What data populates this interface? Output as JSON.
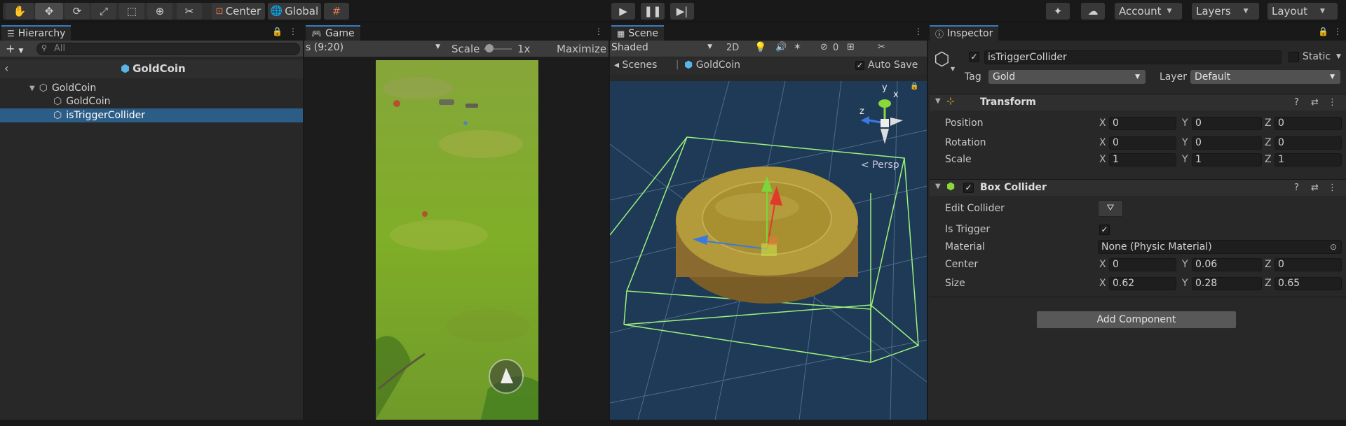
{
  "toolbar": {
    "center_label": "Center",
    "global_label": "Global",
    "account_label": "Account",
    "layers_label": "Layers",
    "layout_label": "Layout"
  },
  "hierarchy": {
    "tab_label": "Hierarchy",
    "search_placeholder": "All",
    "scene_title": "GoldCoin",
    "items": [
      {
        "label": "GoldCoin"
      },
      {
        "label": "GoldCoin"
      },
      {
        "label": "isTriggerCollider"
      }
    ]
  },
  "game": {
    "tab_label": "Game",
    "aspect_label": "s (9:20)",
    "scale_label": "Scale",
    "scale_value": "1x",
    "maximize_label": "Maximize"
  },
  "scene": {
    "tab_label": "Scene",
    "shading_label": "Shaded",
    "mode_2d": "2D",
    "hidden_count": "0",
    "scenes_label": "Scenes",
    "prefab_label": "GoldCoin",
    "autosave_label": "Auto Save",
    "persp_label": "< Persp",
    "gizmo_y": "y",
    "gizmo_x": "x",
    "gizmo_z": "z"
  },
  "inspector": {
    "tab_label": "Inspector",
    "object_name": "isTriggerCollider",
    "static_label": "Static",
    "tag_label": "Tag",
    "tag_value": "Gold",
    "layer_label": "Layer",
    "layer_value": "Default",
    "transform": {
      "title": "Transform",
      "position_label": "Position",
      "rotation_label": "Rotation",
      "scale_label": "Scale",
      "position": {
        "x": "0",
        "y": "0",
        "z": "0"
      },
      "rotation": {
        "x": "0",
        "y": "0",
        "z": "0"
      },
      "scale": {
        "x": "1",
        "y": "1",
        "z": "1"
      }
    },
    "box_collider": {
      "title": "Box Collider",
      "edit_collider_label": "Edit Collider",
      "is_trigger_label": "Is Trigger",
      "material_label": "Material",
      "material_value": "None (Physic Material)",
      "center_label": "Center",
      "size_label": "Size",
      "center": {
        "x": "0",
        "y": "0.06",
        "z": "0"
      },
      "size": {
        "x": "0.62",
        "y": "0.28",
        "z": "0.65"
      }
    },
    "add_component_label": "Add Component"
  },
  "axis_labels": {
    "x": "X",
    "y": "Y",
    "z": "Z"
  },
  "colors": {
    "selection": "#2c5d87",
    "tab_accent": "#3a79bb",
    "scene_bg": "#1e3a57",
    "grass": "#7fa52a",
    "collider_green": "#9cf27a",
    "coin_gold": "#b39a3a"
  }
}
